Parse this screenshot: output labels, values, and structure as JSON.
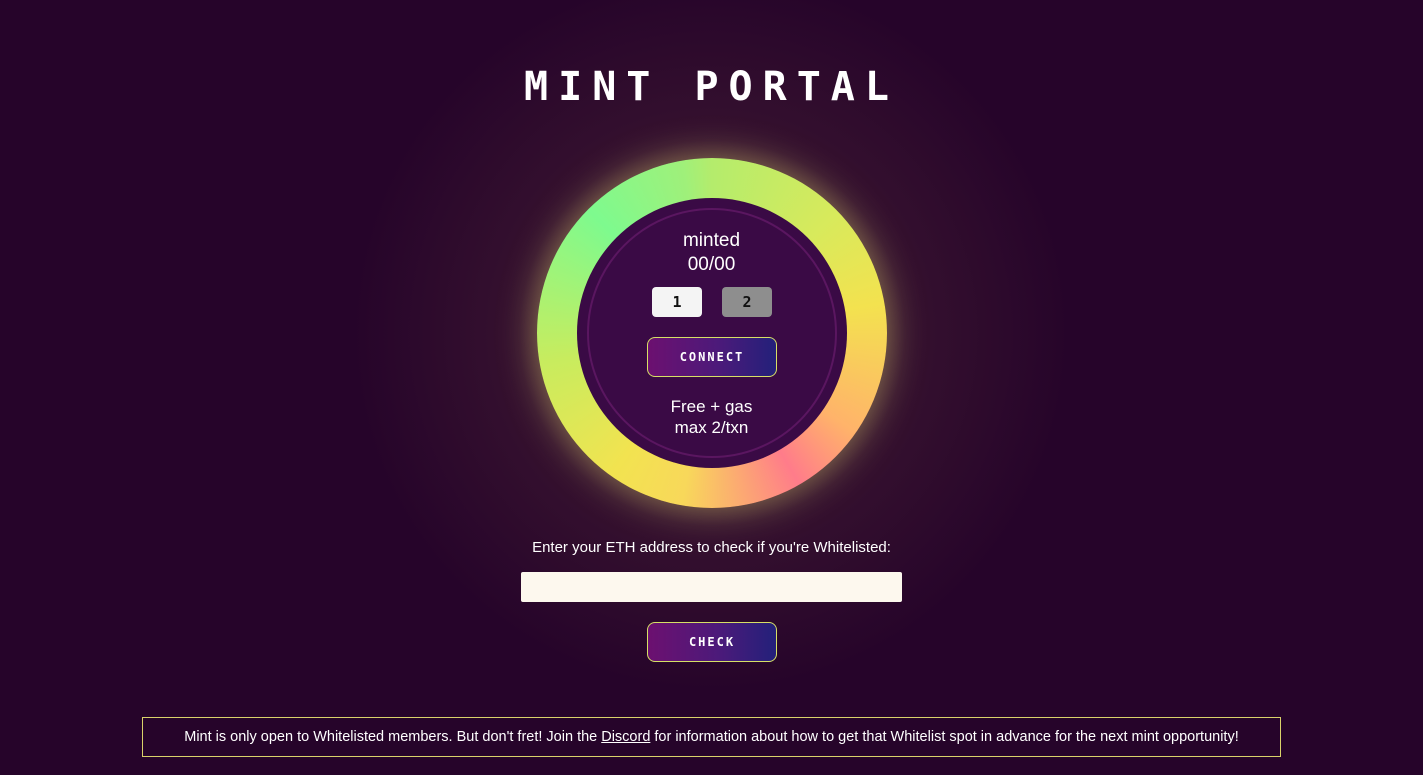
{
  "header": {
    "title": "MINT PORTAL"
  },
  "mint": {
    "minted_label": "minted",
    "minted_count": "00/00",
    "quantity_options": [
      "1",
      "2"
    ],
    "selected_quantity": "1",
    "connect_label": "CONNECT",
    "price_text": "Free + gas",
    "max_text": "max 2/txn"
  },
  "whitelist": {
    "prompt": "Enter your ETH address to check if you're Whitelisted:",
    "input_value": "",
    "input_placeholder": "",
    "check_label": "CHECK"
  },
  "notice": {
    "text_before": "Mint is only open to Whitelisted members. But don't fret! Join the",
    "link_text": "Discord",
    "text_after": "for information about how to get that Whitelist spot in advance for the next mint opportunity!"
  },
  "colors": {
    "background": "#26042a",
    "disk": "#3a0a45",
    "button_border": "#d6e066",
    "notice_border": "#d9d26a"
  }
}
